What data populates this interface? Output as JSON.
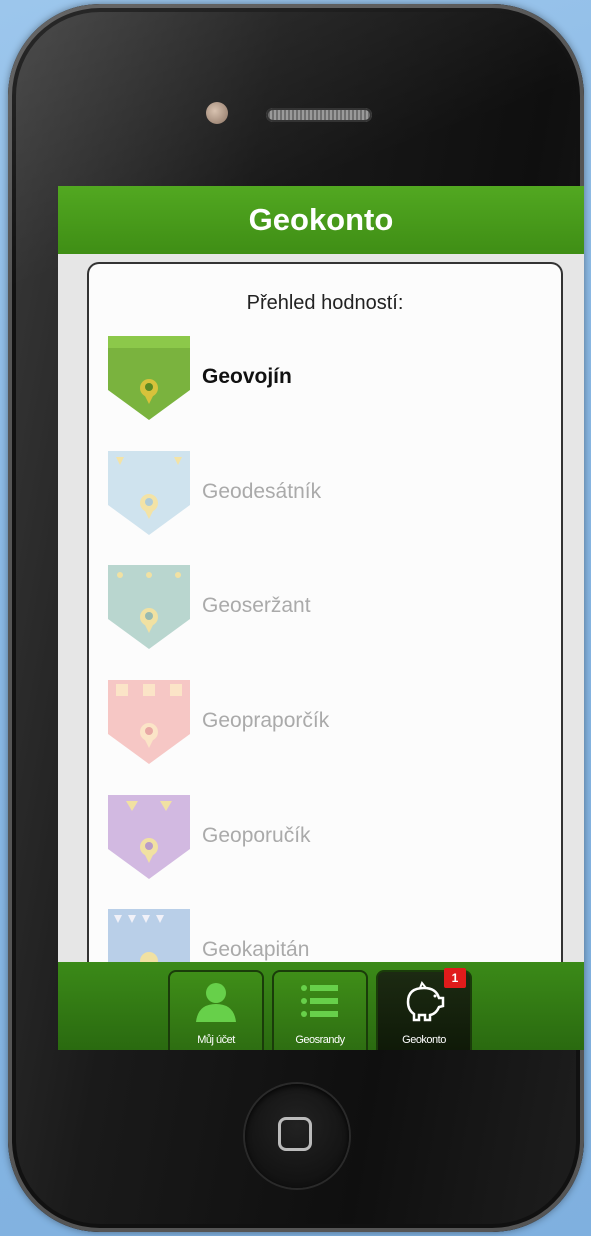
{
  "app": {
    "title": "Geokonto"
  },
  "overview": {
    "heading": "Přehled hodností:"
  },
  "ranks": [
    {
      "label": "Geovojín",
      "color": "#7ab33e",
      "active": true
    },
    {
      "label": "Geodesátník",
      "color": "#cfe3ee",
      "active": false
    },
    {
      "label": "Geoseržant",
      "color": "#b9d6cf",
      "active": false
    },
    {
      "label": "Geopraporčík",
      "color": "#f6c7c5",
      "active": false
    },
    {
      "label": "Geoporučík",
      "color": "#d2b9e1",
      "active": false
    },
    {
      "label": "Geokapitán",
      "color": "#b9cfe8",
      "active": false
    }
  ],
  "tabs": [
    {
      "label": "Můj účet",
      "icon": "user-icon"
    },
    {
      "label": "Geosrandy",
      "icon": "list-icon"
    },
    {
      "label": "Geokonto",
      "icon": "piggy-bank-icon",
      "badge": "1",
      "selected": true
    }
  ],
  "colors": {
    "accent": "#4a9f1d",
    "badge": "#e01b1b"
  }
}
